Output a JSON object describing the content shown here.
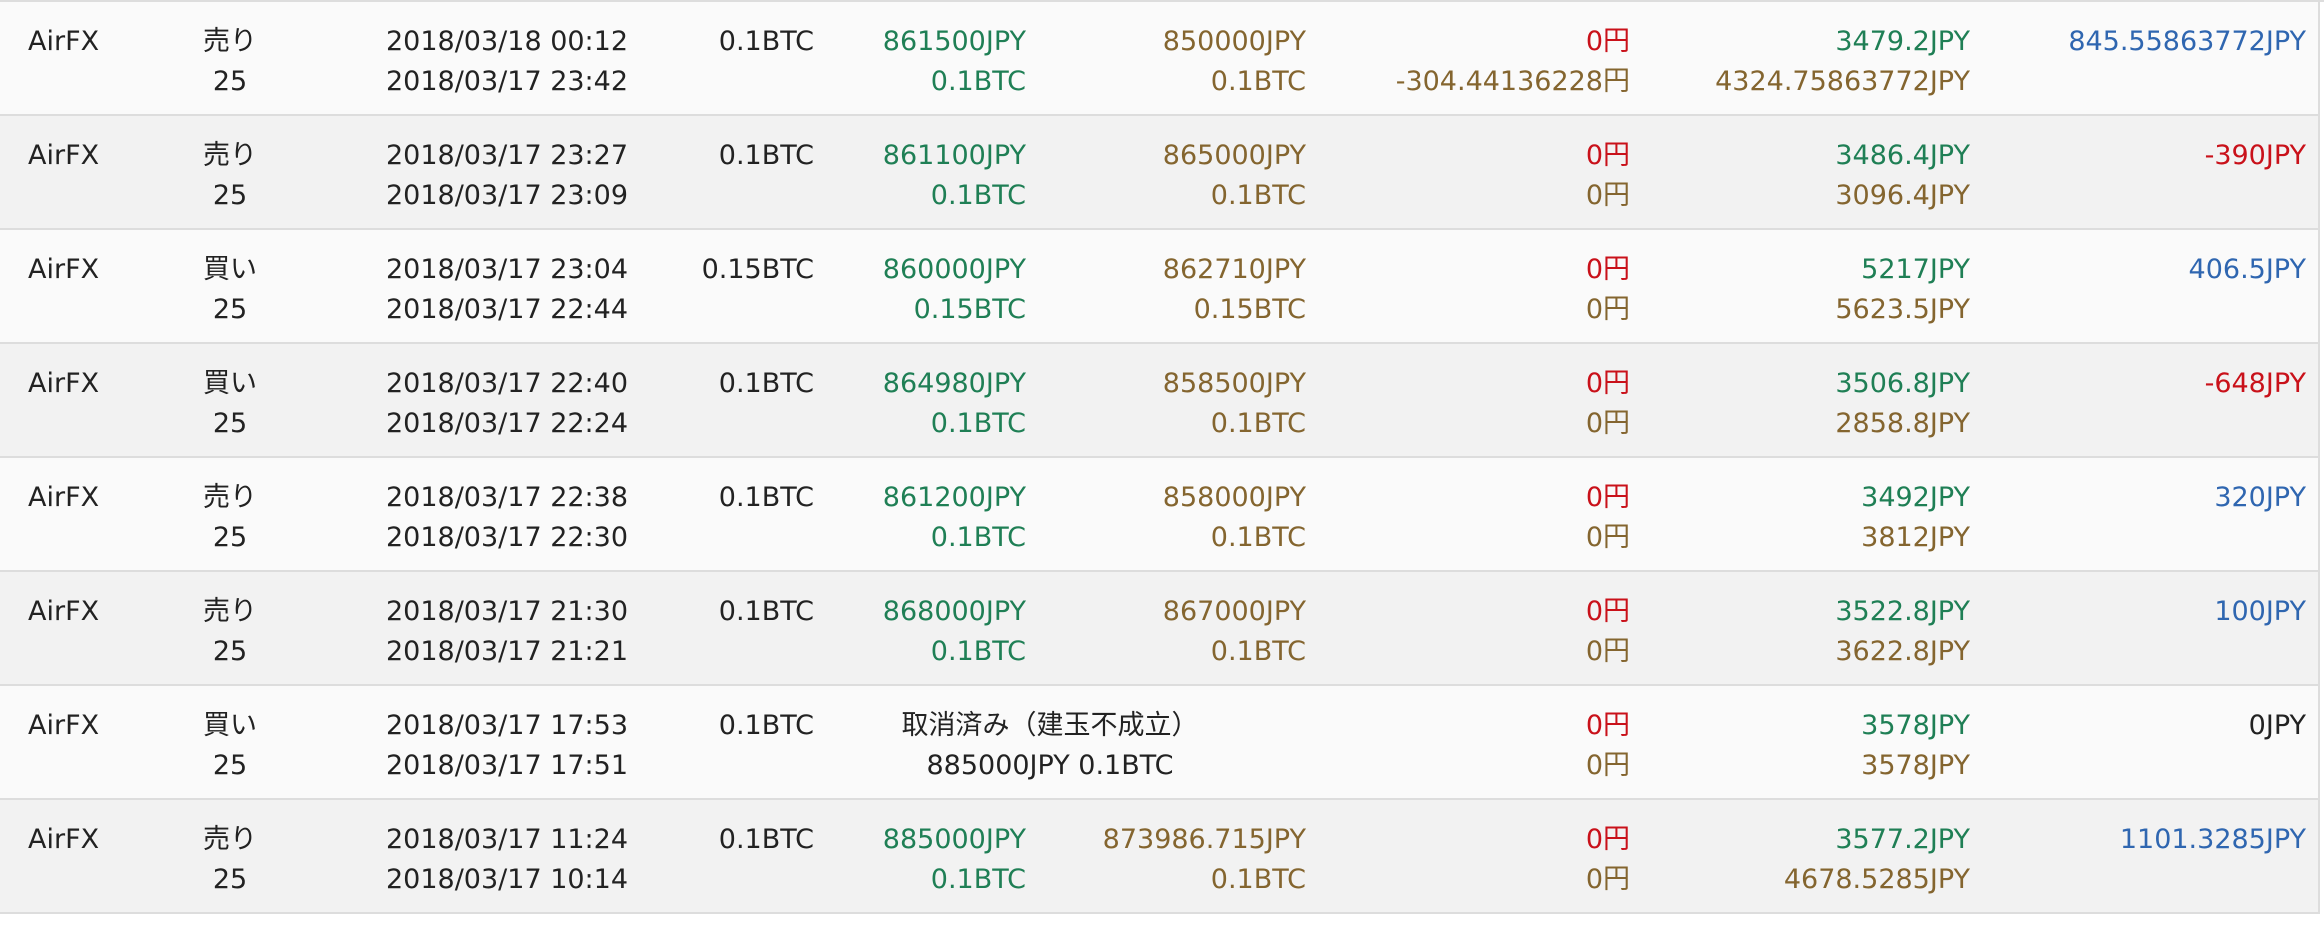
{
  "rows": [
    {
      "exchange": "AirFX",
      "side": "売り",
      "leverage": "25",
      "open_date": "2018/03/18 00:12",
      "close_date": "2018/03/17 23:42",
      "amount": "0.1BTC",
      "open_price": "861500JPY",
      "open_amount": "0.1BTC",
      "close_price": "850000JPY",
      "close_amount": "0.1BTC",
      "fee1": "0円",
      "fee2": "-304.44136228円",
      "margin1": "3479.2JPY",
      "margin2": "4324.75863772JPY",
      "profit": "845.55863772JPY",
      "profit_color": "#2f66b0",
      "canceled": false
    },
    {
      "exchange": "AirFX",
      "side": "売り",
      "leverage": "25",
      "open_date": "2018/03/17 23:27",
      "close_date": "2018/03/17 23:09",
      "amount": "0.1BTC",
      "open_price": "861100JPY",
      "open_amount": "0.1BTC",
      "close_price": "865000JPY",
      "close_amount": "0.1BTC",
      "fee1": "0円",
      "fee2": "0円",
      "margin1": "3486.4JPY",
      "margin2": "3096.4JPY",
      "profit": "-390JPY",
      "profit_color": "#c9111a",
      "canceled": false
    },
    {
      "exchange": "AirFX",
      "side": "買い",
      "leverage": "25",
      "open_date": "2018/03/17 23:04",
      "close_date": "2018/03/17 22:44",
      "amount": "0.15BTC",
      "open_price": "860000JPY",
      "open_amount": "0.15BTC",
      "close_price": "862710JPY",
      "close_amount": "0.15BTC",
      "fee1": "0円",
      "fee2": "0円",
      "margin1": "5217JPY",
      "margin2": "5623.5JPY",
      "profit": "406.5JPY",
      "profit_color": "#2f66b0",
      "canceled": false
    },
    {
      "exchange": "AirFX",
      "side": "買い",
      "leverage": "25",
      "open_date": "2018/03/17 22:40",
      "close_date": "2018/03/17 22:24",
      "amount": "0.1BTC",
      "open_price": "864980JPY",
      "open_amount": "0.1BTC",
      "close_price": "858500JPY",
      "close_amount": "0.1BTC",
      "fee1": "0円",
      "fee2": "0円",
      "margin1": "3506.8JPY",
      "margin2": "2858.8JPY",
      "profit": "-648JPY",
      "profit_color": "#c9111a",
      "canceled": false
    },
    {
      "exchange": "AirFX",
      "side": "売り",
      "leverage": "25",
      "open_date": "2018/03/17 22:38",
      "close_date": "2018/03/17 22:30",
      "amount": "0.1BTC",
      "open_price": "861200JPY",
      "open_amount": "0.1BTC",
      "close_price": "858000JPY",
      "close_amount": "0.1BTC",
      "fee1": "0円",
      "fee2": "0円",
      "margin1": "3492JPY",
      "margin2": "3812JPY",
      "profit": "320JPY",
      "profit_color": "#2f66b0",
      "canceled": false
    },
    {
      "exchange": "AirFX",
      "side": "売り",
      "leverage": "25",
      "open_date": "2018/03/17 21:30",
      "close_date": "2018/03/17 21:21",
      "amount": "0.1BTC",
      "open_price": "868000JPY",
      "open_amount": "0.1BTC",
      "close_price": "867000JPY",
      "close_amount": "0.1BTC",
      "fee1": "0円",
      "fee2": "0円",
      "margin1": "3522.8JPY",
      "margin2": "3622.8JPY",
      "profit": "100JPY",
      "profit_color": "#2f66b0",
      "canceled": false
    },
    {
      "exchange": "AirFX",
      "side": "買い",
      "leverage": "25",
      "open_date": "2018/03/17 17:53",
      "close_date": "2018/03/17 17:51",
      "amount": "0.1BTC",
      "canceled": true,
      "cancel_text": "取消済み（建玉不成立）",
      "cancel_detail": "885000JPY 0.1BTC",
      "fee1": "0円",
      "fee2": "0円",
      "margin1": "3578JPY",
      "margin2": "3578JPY",
      "profit": "0JPY",
      "profit_color": "#222222"
    },
    {
      "exchange": "AirFX",
      "side": "売り",
      "leverage": "25",
      "open_date": "2018/03/17 11:24",
      "close_date": "2018/03/17 10:14",
      "amount": "0.1BTC",
      "open_price": "885000JPY",
      "open_amount": "0.1BTC",
      "close_price": "873986.715JPY",
      "close_amount": "0.1BTC",
      "fee1": "0円",
      "fee2": "0円",
      "margin1": "3577.2JPY",
      "margin2": "4678.5285JPY",
      "profit": "1101.3285JPY",
      "profit_color": "#2f66b0",
      "canceled": false
    }
  ]
}
